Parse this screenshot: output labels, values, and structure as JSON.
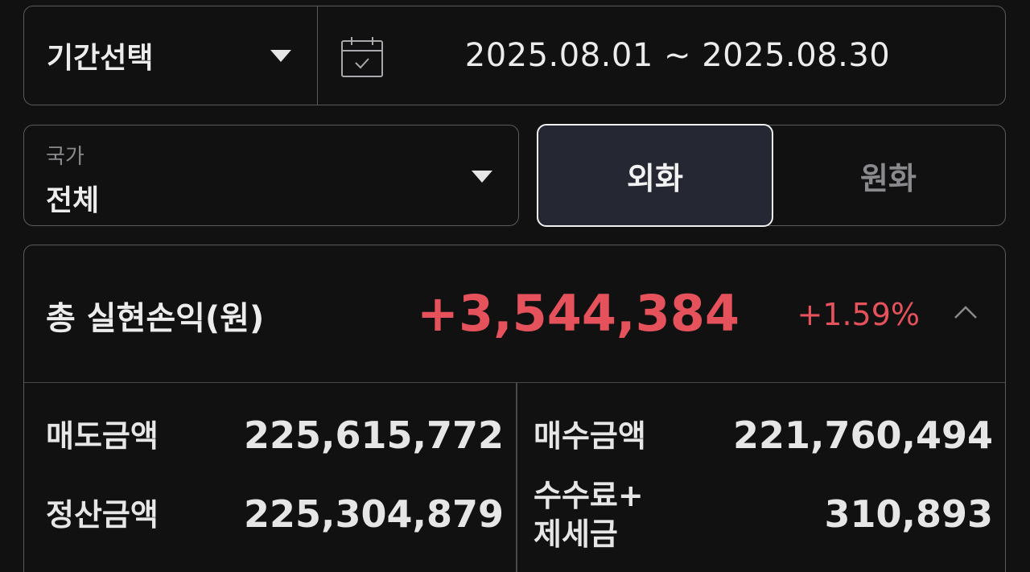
{
  "period": {
    "select_label": "기간선택",
    "date_range": "2025.08.01 ~ 2025.08.30"
  },
  "country": {
    "caption": "국가",
    "value": "전체"
  },
  "currency_toggle": {
    "options": [
      "외화",
      "원화"
    ],
    "selected": "외화"
  },
  "summary": {
    "title": "총 실현손익(원)",
    "amount": "+3,544,384",
    "rate": "+1.59%",
    "accent_color": "#e5525c",
    "rows": [
      {
        "label": "매도금액",
        "value": "225,615,772"
      },
      {
        "label": "매수금액",
        "value": "221,760,494"
      },
      {
        "label": "정산금액",
        "value": "225,304,879"
      },
      {
        "label_line1": "수수료+",
        "label_line2": "제세금",
        "value": "310,893"
      }
    ]
  }
}
